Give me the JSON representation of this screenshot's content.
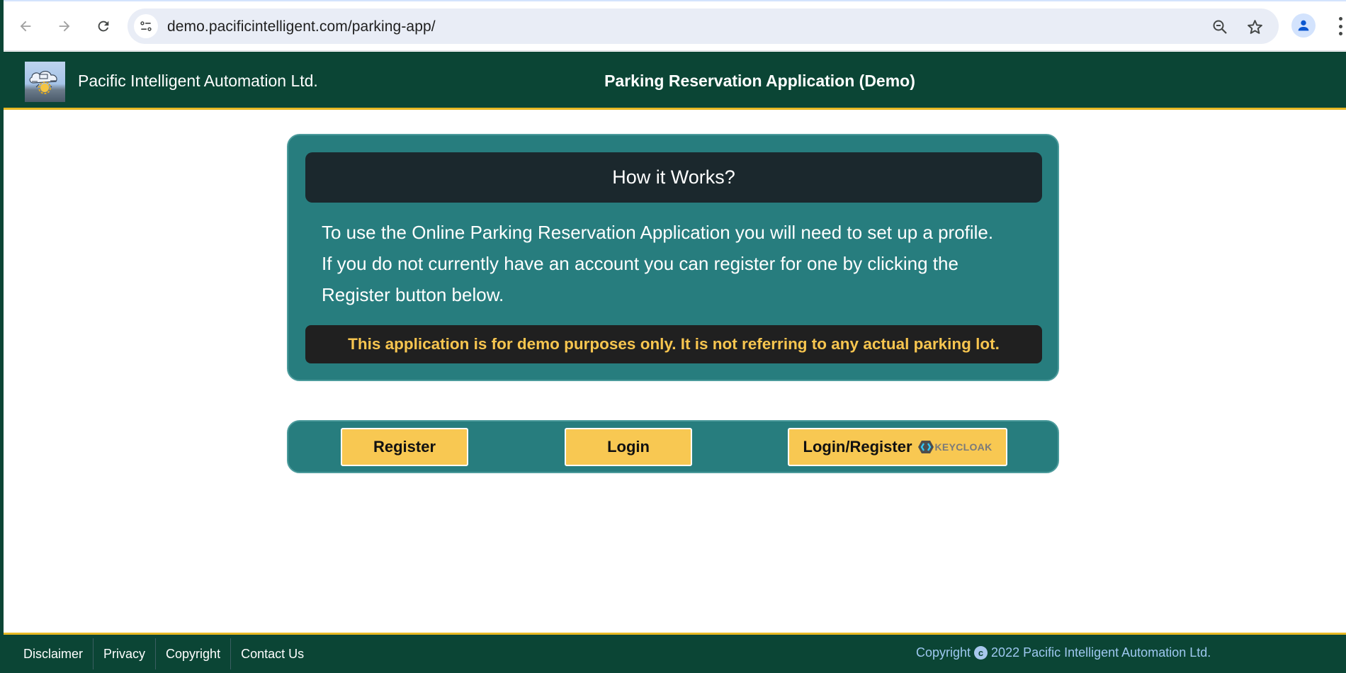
{
  "browser": {
    "url": "demo.pacificintelligent.com/parking-app/",
    "icons": [
      "back-arrow-icon",
      "forward-arrow-icon",
      "reload-icon",
      "site-info-icon",
      "zoom-out-icon",
      "bookmark-star-icon",
      "profile-icon",
      "more-menu-icon"
    ]
  },
  "header": {
    "company_name": "Pacific Intelligent Automation Ltd.",
    "app_title": "Parking Reservation Application (Demo)"
  },
  "info_card": {
    "heading": "How it Works?",
    "body_lines": [
      "To use the Online Parking Reservation Application you will need to set up a profile.",
      "If you do not currently have an account you can register for one by clicking the",
      "Register button below."
    ],
    "notice": "This application is for demo purposes only. It is not referring to any actual parking lot."
  },
  "actions": {
    "register_label": "Register",
    "login_label": "Login",
    "keycloak_label": "Login/Register",
    "keycloak_brand": "KEYCLOAK"
  },
  "footer": {
    "links": [
      "Disclaimer",
      "Privacy",
      "Copyright",
      "Contact Us"
    ],
    "copyright_prefix": "Copyright",
    "copyright_symbol": "c",
    "copyright_text": "2022 Pacific Intelligent Automation Ltd."
  },
  "colors": {
    "header_bg": "#0b4535",
    "accent_line": "#e8b923",
    "card_bg": "#277d7e",
    "card_head_bg": "#1b282d",
    "notice_text": "#f7c54f",
    "button_bg": "#f8c852",
    "footer_copyright": "#9ec8f0"
  }
}
